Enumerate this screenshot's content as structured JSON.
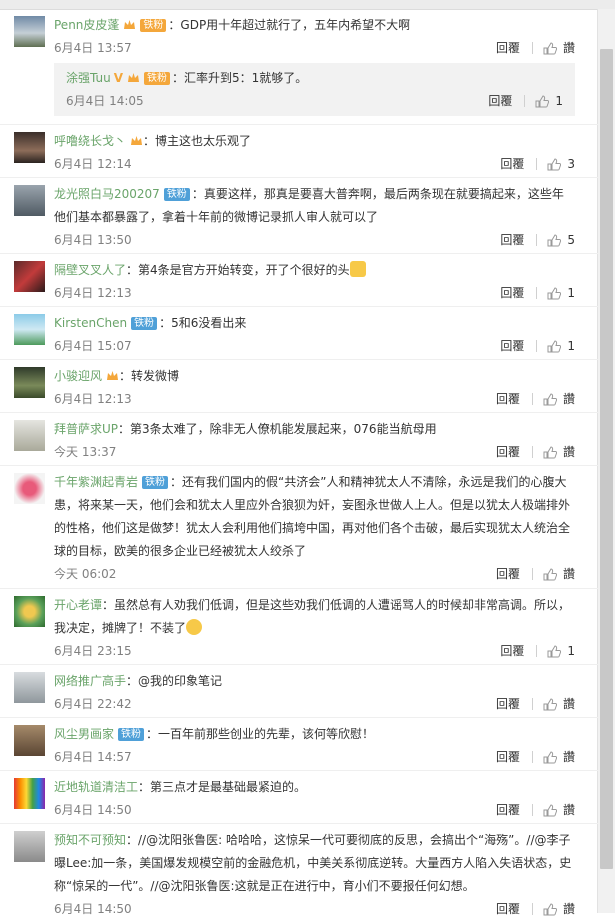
{
  "comments": [
    {
      "user": "Penn皮皮蓬",
      "badge": "铁粉",
      "badge_color": "gold",
      "crown": true,
      "text": "：GDP用十年超过就行了，五年内希望不大啊",
      "time": "6月4日 13:57",
      "reply": "回覆",
      "like": "讚",
      "sub": {
        "user": "涂强Tuu",
        "v": "V",
        "badge": "铁粉",
        "text": "：汇率升到5：1就够了。",
        "time": "6月4日 14:05",
        "reply": "回覆",
        "like": "1"
      }
    },
    {
      "user": "呼噜绕长戈丶",
      "crown": true,
      "text": "：博主这也太乐观了",
      "time": "6月4日 12:14",
      "reply": "回覆",
      "like": "3"
    },
    {
      "user": "龙光照白马200207",
      "badge": "铁粉",
      "text": "：真要这样，那真是要喜大普奔啊，最后两条现在就要搞起来，这些年他们基本都暴露了，拿着十年前的微博记录抓人审人就可以了",
      "time": "6月4日 13:50",
      "reply": "回覆",
      "like": "5"
    },
    {
      "user": "隔壁叉叉人了",
      "text": "：第4条是官方开始转变，开了个很好的头",
      "emoji": "thumbs",
      "time": "6月4日 12:13",
      "reply": "回覆",
      "like": "1"
    },
    {
      "user": "KirstenChen",
      "badge": "铁粉",
      "text": "：5和6没看出来",
      "time": "6月4日 15:07",
      "reply": "回覆",
      "like": "1"
    },
    {
      "user": "小骏迎风",
      "crown": true,
      "text": "：转发微博",
      "time": "6月4日 12:13",
      "reply": "回覆",
      "like": "讚"
    },
    {
      "user": "拜普萨求UP",
      "text": "：第3条太难了，除非无人僚机能发展起来，076能当航母用",
      "time": "今天 13:37",
      "reply": "回覆",
      "like": "讚"
    },
    {
      "user": "千年紫渊起青岩",
      "badge": "铁粉",
      "text": "：还有我们国内的假“共济会”人和精神犹太人不清除，永远是我们的心腹大患，将来某一天，他们会和犹太人里应外合狼狈为奸，妄图永世做人上人。但是以犹太人极端排外的性格，他们这是做梦！犹太人会利用他们搞垮中国，再对他们各个击破，最后实现犹太人统治全球的目标，欧美的很多企业已经被犹太人绞杀了",
      "time": "今天 06:02",
      "reply": "回覆",
      "like": "讚"
    },
    {
      "user": "开心老谭",
      "text": "：虽然总有人劝我们低调，但是这些劝我们低调的人遭谣骂人的时候却非常高调。所以，我决定，摊牌了！不装了",
      "emoji": "face",
      "time": "6月4日 23:15",
      "reply": "回覆",
      "like": "1"
    },
    {
      "user": "网络推广高手",
      "text": "：@我的印象笔记",
      "time": "6月4日 22:42",
      "reply": "回覆",
      "like": "讚"
    },
    {
      "user": "风尘男画家",
      "badge": "铁粉",
      "text": "：一百年前那些创业的先辈，该何等欣慰！",
      "time": "6月4日 14:57",
      "reply": "回覆",
      "like": "讚"
    },
    {
      "user": "近地轨道清洁工",
      "text": "：第三点才是最基础最紧迫的。",
      "time": "6月4日 14:50",
      "reply": "回覆",
      "like": "讚"
    },
    {
      "user": "预知不可预知",
      "text": "：//@沈阳张鲁医: 哈哈哈，这惊呆一代可要彻底的反思，会搞出个“海殇”。//@李子曝Lee:加一条，美国爆发规模空前的金融危机，中美关系彻底逆转。大量西方人陷入失语状态，史称“惊呆的一代”。//@沈阳张鲁医:这就是正在进行中，育小们不要报任何幻想。",
      "time": "6月4日 14:50",
      "reply": "回覆",
      "like": "讚"
    }
  ],
  "colors": {
    "link": "#4f8bd0",
    "badge": "#4fa0d8",
    "gold": "#f4a73b",
    "meta": "#808080"
  }
}
